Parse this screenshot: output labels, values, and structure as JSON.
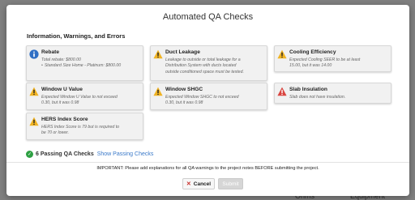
{
  "background": {
    "labels": [
      "Ohms",
      "Equipment"
    ]
  },
  "modal": {
    "title": "Automated QA Checks",
    "section_heading": "Information, Warnings, and Errors"
  },
  "cards": {
    "rebate": {
      "icon": "info-icon",
      "title": "Rebate",
      "line1": "Total rebate: $800.00",
      "line2": "Standard Size Home - Platinum: $800.00"
    },
    "duct": {
      "icon": "warning-icon",
      "title": "Duct Leakage",
      "line1": "Leakage to outside or total leakage for a",
      "line2": "Distribution System with ducts located",
      "line3": "outside conditioned space must be tested."
    },
    "cooling": {
      "icon": "warning-icon",
      "title": "Cooling Efficiency",
      "line1": "Expected Cooling SEER to be at least",
      "line2": "15.00, but it was 14.00"
    },
    "window_u": {
      "icon": "warning-icon",
      "title": "Window U Value",
      "line1": "Expected Window U Value to not exceed",
      "line2": "0.30, but it was 0.98"
    },
    "window_shgc": {
      "icon": "warning-icon",
      "title": "Window SHGC",
      "line1": "Expected Window SHGC to not exceed",
      "line2": "0.30, but it was 0.98"
    },
    "slab": {
      "icon": "error-icon",
      "title": "Slab Insulation",
      "line1": "Slab does not have insulation."
    },
    "hers": {
      "icon": "warning-icon",
      "title": "HERS Index Score",
      "line1": "HERS Index Score is 79 but is required to",
      "line2": "be 70 or lower."
    }
  },
  "passing": {
    "count_label": "6 Passing QA Checks",
    "link_label": "Show Passing Checks"
  },
  "notice": "IMPORTANT: Please add explanations for all QA warnings to the project notes BEFORE submitting the project.",
  "buttons": {
    "cancel": "Cancel",
    "submit": "Submit"
  },
  "colors": {
    "info": "#2f6fc4",
    "warning": "#f0b323",
    "error": "#d9443f",
    "success": "#2ea043",
    "link": "#3a79c9"
  }
}
